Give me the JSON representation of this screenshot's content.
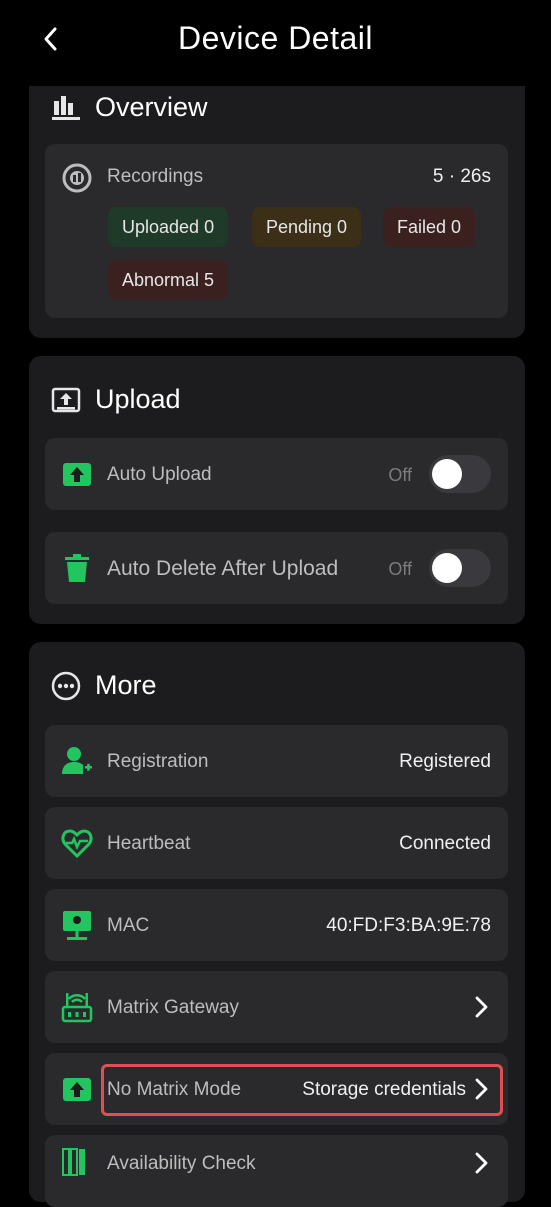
{
  "header": {
    "title": "Device Detail"
  },
  "overview": {
    "title": "Overview",
    "recordings": {
      "label": "Recordings",
      "value": "5 · 26s",
      "chips": {
        "uploaded": "Uploaded 0",
        "pending": "Pending 0",
        "failed": "Failed 0",
        "abnormal": "Abnormal 5"
      }
    }
  },
  "upload": {
    "title": "Upload",
    "auto_upload": {
      "label": "Auto Upload",
      "state": "Off"
    },
    "auto_delete": {
      "label": "Auto Delete After Upload",
      "state": "Off"
    }
  },
  "more": {
    "title": "More",
    "registration": {
      "label": "Registration",
      "value": "Registered"
    },
    "heartbeat": {
      "label": "Heartbeat",
      "value": "Connected"
    },
    "mac": {
      "label": "MAC",
      "value": "40:FD:F3:BA:9E:78"
    },
    "matrix_gateway": {
      "label": "Matrix Gateway"
    },
    "no_matrix_mode": {
      "label": "No Matrix Mode",
      "value": "Storage credentials"
    },
    "availability_check": {
      "label": "Availability Check"
    }
  },
  "colors": {
    "accent": "#22c55e",
    "highlight": "#e05050",
    "panel": "#1c1c1e",
    "card": "#2a2a2d"
  }
}
